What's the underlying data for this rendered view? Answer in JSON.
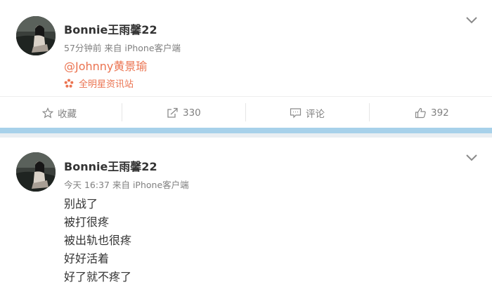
{
  "posts": [
    {
      "username": "Bonnie王雨馨22",
      "meta": "57分钟前 来自 iPhone客户端",
      "mention": "@Johnny黄景瑜",
      "source": "全明星资讯站",
      "actions": {
        "favorite": "收藏",
        "share": "330",
        "comment": "评论",
        "like": "392"
      }
    },
    {
      "username": "Bonnie王雨馨22",
      "meta": "今天 16:37 来自 iPhone客户端",
      "lines": [
        "别战了",
        "被打很疼",
        "被出轨也很疼",
        "好好活着",
        "好了就不疼了"
      ]
    }
  ],
  "colors": {
    "accent": "#eb7350",
    "meta_text": "#808080",
    "divider_blue": "#a7d1ea"
  },
  "icons": [
    "chevron-down-icon",
    "star-icon",
    "share-icon",
    "comment-icon",
    "thumbs-up-icon",
    "source-flower-icon"
  ]
}
